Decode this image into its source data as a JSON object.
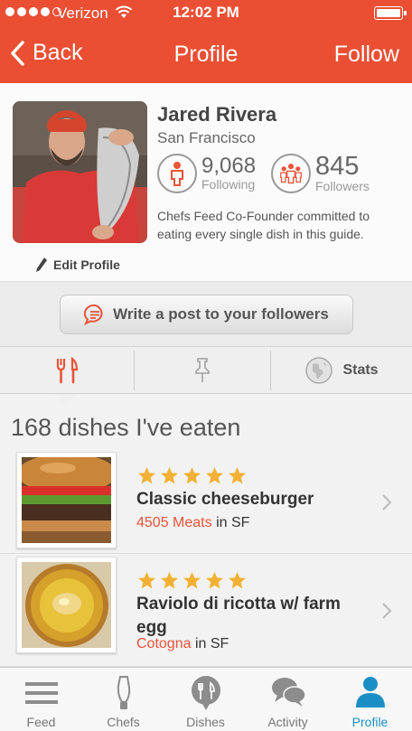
{
  "status_bar": {
    "carrier": "Verizon",
    "time": "12:02 PM"
  },
  "nav": {
    "back_label": "Back",
    "title": "Profile",
    "follow_label": "Follow"
  },
  "profile": {
    "name": "Jared Rivera",
    "city": "San Francisco",
    "following_count": "9,068",
    "following_label": "Following",
    "followers_count": "845",
    "followers_label": "Followers",
    "bio": "Chefs Feed Co-Founder committed to eating every single dish in this guide.",
    "edit_label": "Edit Profile"
  },
  "post_button": {
    "label": "Write a post to your followers"
  },
  "tabs": {
    "stats_label": "Stats"
  },
  "dishes": {
    "count": "168",
    "heading_rest": "dishes I've eaten",
    "items": [
      {
        "name": "Classic cheeseburger",
        "restaurant": "4505 Meats",
        "location": "in SF",
        "stars": 5
      },
      {
        "name": "Raviolo di ricotta w/ farm egg",
        "restaurant": "Cotogna",
        "location": "in SF",
        "stars": 5
      }
    ]
  },
  "tabbar": {
    "items": [
      "Feed",
      "Chefs",
      "Dishes",
      "Activity",
      "Profile"
    ],
    "active": "Profile"
  },
  "colors": {
    "brand": "#ea4f34",
    "active_tab": "#1a8fc6",
    "star": "#f2b134"
  }
}
